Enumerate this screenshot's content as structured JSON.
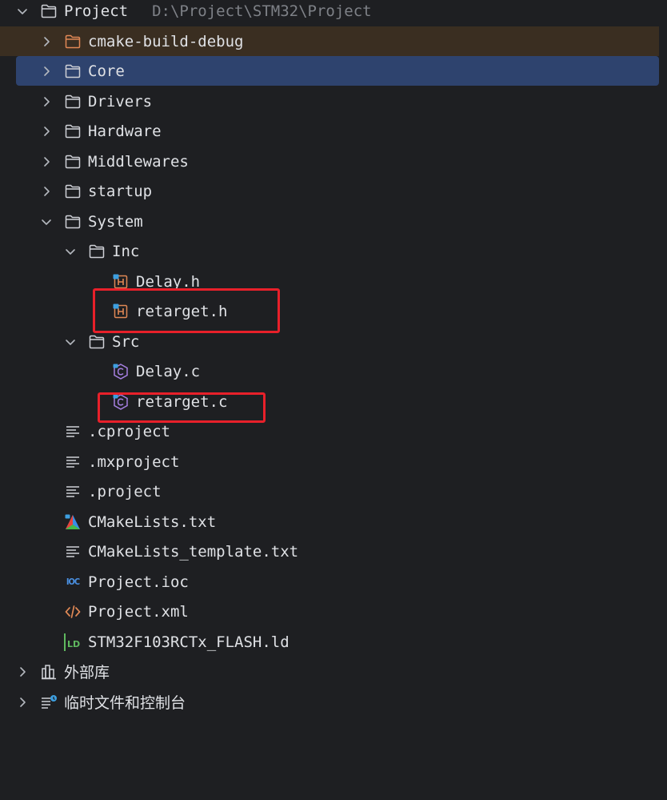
{
  "tree": {
    "root": {
      "label": "Project",
      "path": "D:\\Project\\STM32\\Project"
    },
    "items": [
      {
        "label": "cmake-build-debug"
      },
      {
        "label": "Core"
      },
      {
        "label": "Drivers"
      },
      {
        "label": "Hardware"
      },
      {
        "label": "Middlewares"
      },
      {
        "label": "startup"
      },
      {
        "label": "System"
      },
      {
        "label": "Inc"
      },
      {
        "label": "Delay.h"
      },
      {
        "label": "retarget.h"
      },
      {
        "label": "Src"
      },
      {
        "label": "Delay.c"
      },
      {
        "label": "retarget.c"
      },
      {
        "label": ".cproject"
      },
      {
        "label": ".mxproject"
      },
      {
        "label": ".project"
      },
      {
        "label": "CMakeLists.txt"
      },
      {
        "label": "CMakeLists_template.txt"
      },
      {
        "label": "Project.ioc"
      },
      {
        "label": "Project.xml"
      },
      {
        "label": "STM32F103RCTx_FLASH.ld"
      }
    ],
    "external_libraries": {
      "label": "外部库"
    },
    "scratches": {
      "label": "临时文件和控制台"
    }
  },
  "icons": {
    "ioc_text": "IOC",
    "ld_text": "LD",
    "header_letter": "H",
    "c_letter": "C"
  },
  "colors": {
    "background": "#1e1f22",
    "selection": "#2e436e",
    "excluded_row": "#3a2e21",
    "annotation": "#e8202a"
  }
}
